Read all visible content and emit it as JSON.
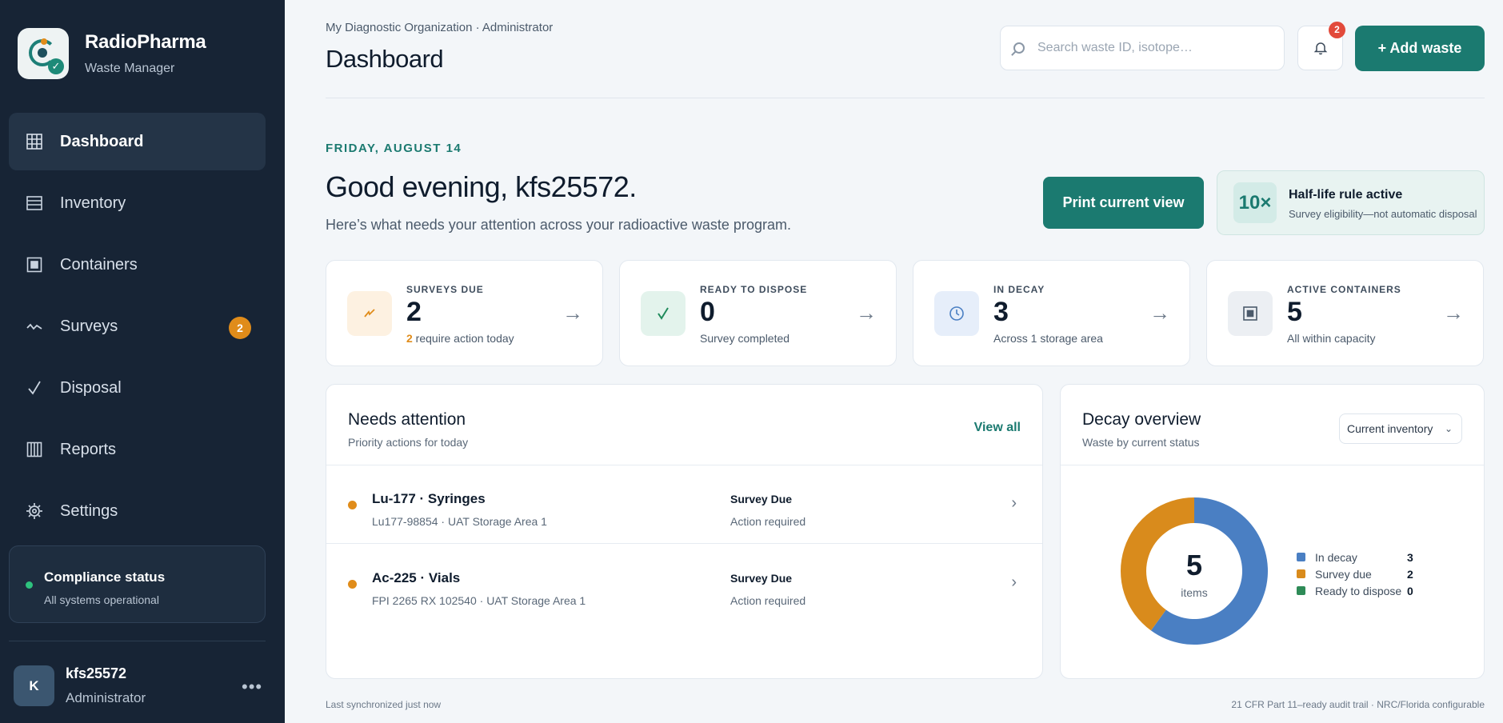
{
  "brand": {
    "name": "RadioPharma",
    "subtitle": "Waste Manager"
  },
  "nav": [
    {
      "label": "Dashboard",
      "icon": "grid-icon",
      "active": true
    },
    {
      "label": "Inventory",
      "icon": "list-icon"
    },
    {
      "label": "Containers",
      "icon": "container-icon"
    },
    {
      "label": "Surveys",
      "icon": "pulse-icon",
      "badge": "2"
    },
    {
      "label": "Disposal",
      "icon": "check-icon"
    },
    {
      "label": "Reports",
      "icon": "columns-icon"
    },
    {
      "label": "Settings",
      "icon": "gear-icon"
    }
  ],
  "compliance": {
    "title": "Compliance status",
    "subtitle": "All systems operational"
  },
  "user": {
    "initial": "K",
    "name": "kfs25572",
    "role": "Administrator",
    "more": "•••"
  },
  "header": {
    "org": "My Diagnostic Organization · Administrator",
    "title": "Dashboard",
    "search_placeholder": "Search waste ID, isotope…",
    "notifications_count": "2",
    "add_label": "+ Add waste"
  },
  "welcome": {
    "date": "FRIDAY, AUGUST 14",
    "greeting": "Good evening, kfs25572.",
    "subtitle": "Here’s what needs your attention across your radioactive waste program.",
    "print_label": "Print current view",
    "halflife_mark": "10×",
    "halflife_title": "Half-life rule active",
    "halflife_sub": "Survey eligibility—not automatic disposal"
  },
  "stats": [
    {
      "label": "SURVEYS DUE",
      "value": "2",
      "sub_num": "2",
      "sub": " require action today",
      "icon": "bolt-icon"
    },
    {
      "label": "READY TO DISPOSE",
      "value": "0",
      "sub": "Survey completed",
      "icon": "check-icon"
    },
    {
      "label": "IN DECAY",
      "value": "3",
      "sub": "Across 1 storage area",
      "icon": "clock-icon"
    },
    {
      "label": "ACTIVE CONTAINERS",
      "value": "5",
      "sub": "All within capacity",
      "icon": "container-icon"
    }
  ],
  "attention": {
    "title": "Needs attention",
    "subtitle": "Priority actions for today",
    "view_all": "View all",
    "rows": [
      {
        "title": "Lu-177 · Syringes",
        "sub": "Lu177-98854 · UAT Storage Area 1",
        "status": "Survey Due",
        "action": "Action required"
      },
      {
        "title": "Ac-225 · Vials",
        "sub": "FPI 2265 RX 102540 · UAT Storage Area 1",
        "status": "Survey Due",
        "action": "Action required"
      }
    ]
  },
  "decay": {
    "title": "Decay overview",
    "subtitle": "Waste by current status",
    "select_value": "Current inventory",
    "total": "5",
    "unit": "items"
  },
  "chart_data": {
    "type": "pie",
    "categories": [
      "In decay",
      "Survey due",
      "Ready to dispose"
    ],
    "values": [
      3,
      2,
      0
    ],
    "colors": [
      "#4a7fc3",
      "#d98b1c",
      "#2e8b57"
    ],
    "legend": "right"
  },
  "footer": {
    "left": "Last synchronized just now",
    "right": "21 CFR Part 11–ready audit trail · NRC/Florida configurable"
  }
}
